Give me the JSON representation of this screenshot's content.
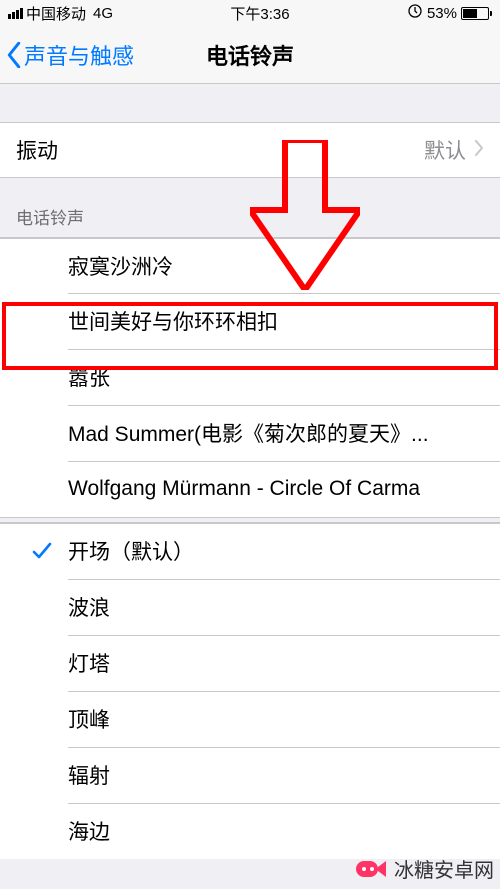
{
  "status": {
    "carrier": "中国移动",
    "network": "4G",
    "time": "下午3:36",
    "lock_icon": "⏳",
    "battery_pct": "53%"
  },
  "nav": {
    "back_label": "声音与触感",
    "title": "电话铃声"
  },
  "vibration": {
    "label": "振动",
    "value": "默认"
  },
  "section_header": "电话铃声",
  "custom_tones": [
    "寂寞沙洲冷",
    "世间美好与你环环相扣",
    "嚣张",
    "Mad Summer(电影《菊次郎的夏天》...",
    "Wolfgang Mürmann - Circle Of Carma"
  ],
  "builtin_tones": [
    {
      "label": "开场（默认）",
      "checked": true
    },
    {
      "label": "波浪",
      "checked": false
    },
    {
      "label": "灯塔",
      "checked": false
    },
    {
      "label": "顶峰",
      "checked": false
    },
    {
      "label": "辐射",
      "checked": false
    },
    {
      "label": "海边",
      "checked": false
    }
  ],
  "watermark": "冰糖安卓网"
}
